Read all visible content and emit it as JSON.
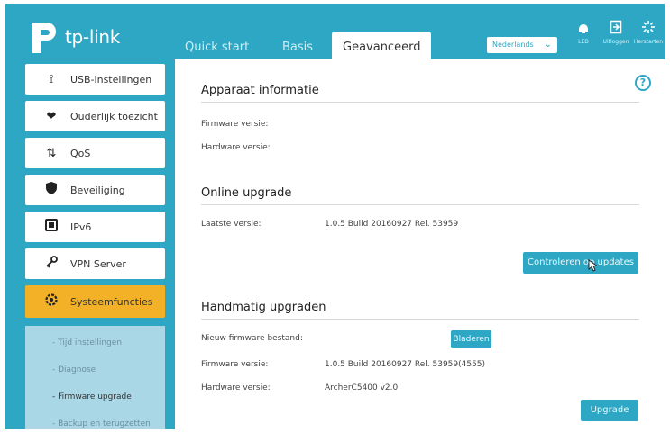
{
  "header": {
    "brand": "tp-link",
    "tabs": [
      {
        "label": "Quick start"
      },
      {
        "label": "Basis"
      },
      {
        "label": "Geavanceerd"
      }
    ],
    "language": "Nederlands",
    "icons": [
      {
        "name": "led-icon",
        "label": "LED"
      },
      {
        "name": "logout-icon",
        "label": "Uitloggen"
      },
      {
        "name": "reboot-icon",
        "label": "Herstarten"
      }
    ]
  },
  "sidebar": {
    "items": [
      {
        "label": "USB-instellingen",
        "icon": "usb-icon"
      },
      {
        "label": "Ouderlijk toezicht",
        "icon": "parental-control-icon"
      },
      {
        "label": "QoS",
        "icon": "qos-icon"
      },
      {
        "label": "Beveiliging",
        "icon": "shield-icon"
      },
      {
        "label": "IPv6",
        "icon": "ipv6-icon"
      },
      {
        "label": "VPN Server",
        "icon": "vpn-icon"
      },
      {
        "label": "Systeemfuncties",
        "icon": "gear-icon"
      }
    ],
    "subitems": [
      {
        "label": "- Tijd instellingen"
      },
      {
        "label": "- Diagnose"
      },
      {
        "label": "- Firmware upgrade"
      },
      {
        "label": "- Backup en terugzetten"
      }
    ]
  },
  "main": {
    "device_info": {
      "title": "Apparaat informatie",
      "firmware_label": "Firmware versie:",
      "hardware_label": "Hardware versie:"
    },
    "online_upgrade": {
      "title": "Online upgrade",
      "latest_label": "Laatste versie:",
      "latest_value": "1.0.5 Build 20160927 Rel. 53959",
      "check_button": "Controleren op updates"
    },
    "manual_upgrade": {
      "title": "Handmatig upgraden",
      "new_fw_label": "Nieuw firmware bestand:",
      "browse_button": "Bladeren",
      "firmware_label": "Firmware versie:",
      "firmware_value": "1.0.5 Build 20160927 Rel. 53959(4555)",
      "hardware_label": "Hardware versie:",
      "hardware_value": "ArcherC5400 v2.0",
      "upgrade_button": "Upgrade"
    }
  },
  "colors": {
    "brand": "#2ea7c4",
    "active_menu": "#f2b126"
  }
}
